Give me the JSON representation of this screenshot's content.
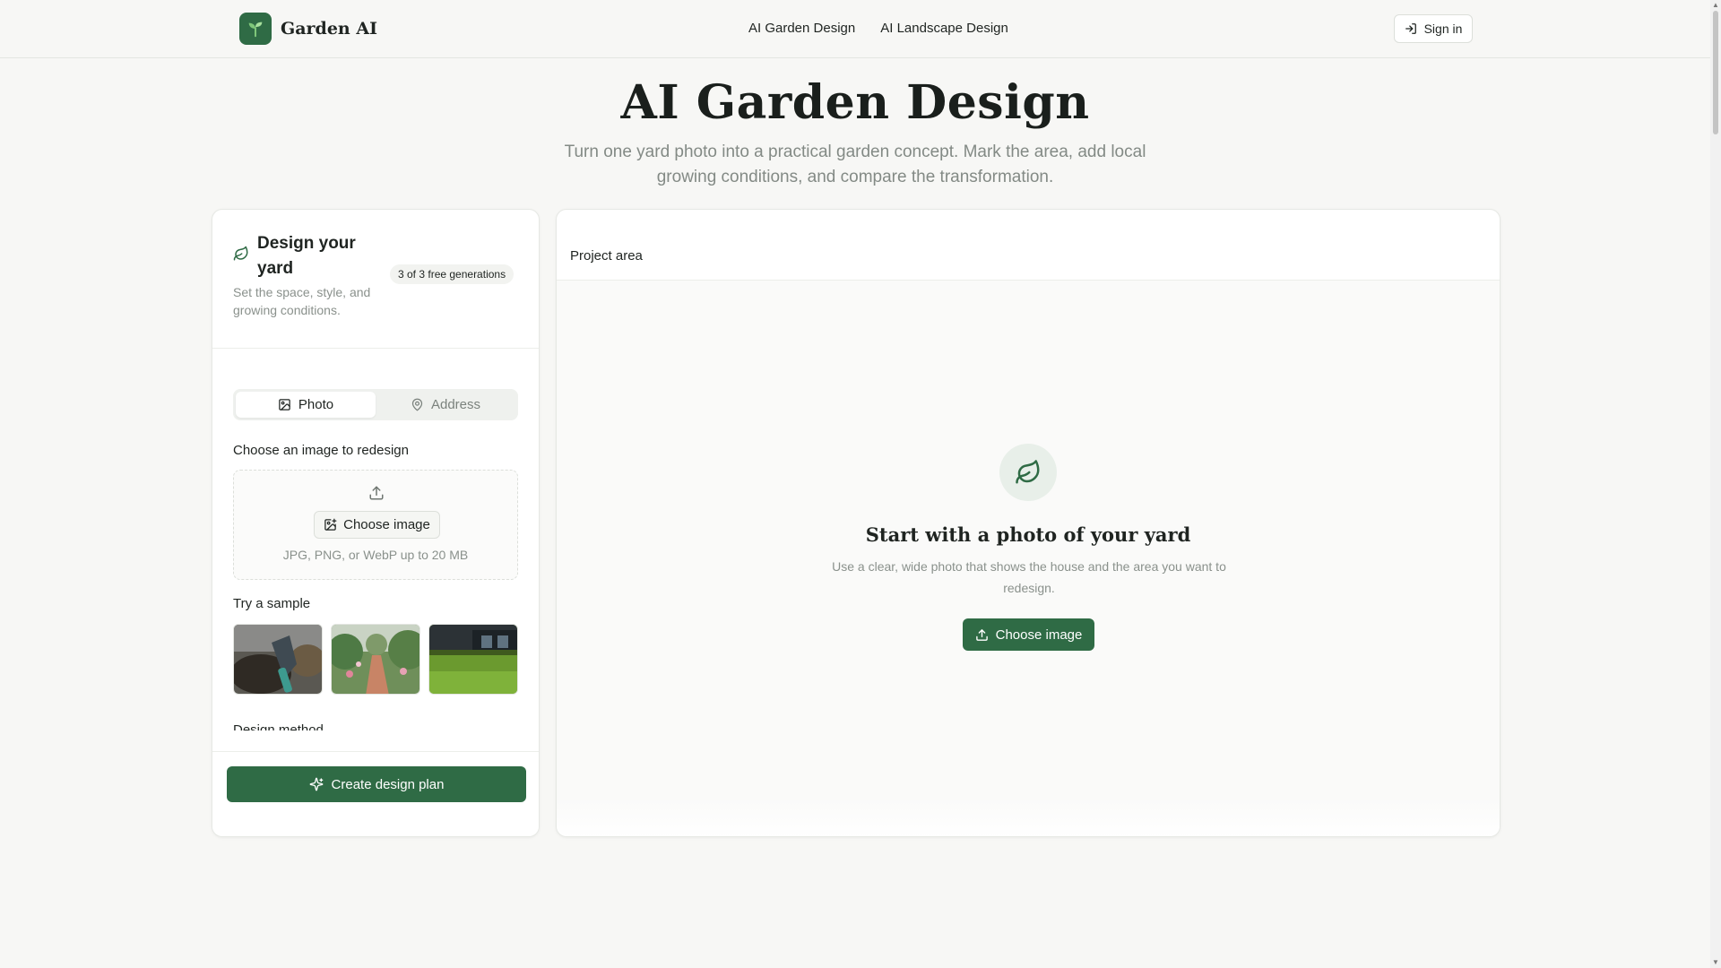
{
  "header": {
    "brand_name": "Garden AI",
    "nav": [
      "AI Garden Design",
      "AI Landscape Design"
    ],
    "signin_label": "Sign in"
  },
  "hero": {
    "title": "AI Garden Design",
    "subtitle": "Turn one yard photo into a practical garden concept. Mark the area, add local growing conditions, and compare the transformation."
  },
  "left_panel": {
    "title": "Design your yard",
    "description": "Set the space, style, and growing conditions.",
    "badge": "3 of 3 free generations",
    "tabs": [
      {
        "label": "Photo",
        "icon": "image-icon",
        "active": true
      },
      {
        "label": "Address",
        "icon": "map-pin-icon",
        "active": false
      }
    ],
    "choose_label": "Choose an image to redesign",
    "choose_button": "Choose image",
    "file_hint": "JPG, PNG, or WebP up to 20 MB",
    "sample_label": "Try a sample",
    "samples": [
      "soil-trowel",
      "garden-path",
      "lawn"
    ],
    "method_label": "Design method",
    "create_button": "Create design plan"
  },
  "right_panel": {
    "title": "Project area",
    "empty_title": "Start with a photo of your yard",
    "empty_description": "Use a clear, wide photo that shows the house and the area you want to redesign.",
    "empty_button": "Choose image"
  },
  "colors": {
    "accent": "#2f6b45",
    "background": "#f7f7f5",
    "muted_text": "#8a918c"
  }
}
